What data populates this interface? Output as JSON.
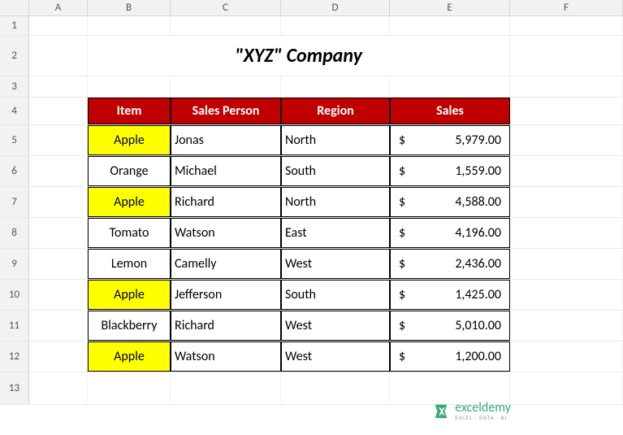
{
  "columns": [
    "A",
    "B",
    "C",
    "D",
    "E",
    "F"
  ],
  "row_labels": [
    "1",
    "2",
    "3",
    "4",
    "5",
    "6",
    "7",
    "8",
    "9",
    "10",
    "11",
    "12",
    "13"
  ],
  "title": "\"XYZ\" Company",
  "headers": {
    "item": "Item",
    "sales_person": "Sales Person",
    "region": "Region",
    "sales": "Sales"
  },
  "rows": [
    {
      "item": "Apple",
      "highlight": true,
      "sales_person": "Jonas",
      "region": "North",
      "currency": "$",
      "sales": "5,979.00"
    },
    {
      "item": "Orange",
      "highlight": false,
      "sales_person": "Michael",
      "region": "South",
      "currency": "$",
      "sales": "1,559.00"
    },
    {
      "item": "Apple",
      "highlight": true,
      "sales_person": "Richard",
      "region": "North",
      "currency": "$",
      "sales": "4,588.00"
    },
    {
      "item": "Tomato",
      "highlight": false,
      "sales_person": "Watson",
      "region": "East",
      "currency": "$",
      "sales": "4,196.00"
    },
    {
      "item": "Lemon",
      "highlight": false,
      "sales_person": "Camelly",
      "region": "West",
      "currency": "$",
      "sales": "2,436.00"
    },
    {
      "item": "Apple",
      "highlight": true,
      "sales_person": "Jefferson",
      "region": "South",
      "currency": "$",
      "sales": "1,425.00"
    },
    {
      "item": "Blackberry",
      "highlight": false,
      "sales_person": "Richard",
      "region": "West",
      "currency": "$",
      "sales": "5,010.00"
    },
    {
      "item": "Apple",
      "highlight": true,
      "sales_person": "Watson",
      "region": "West",
      "currency": "$",
      "sales": "1,200.00"
    }
  ],
  "watermark": {
    "main": "exceldemy",
    "sub": "EXCEL · DATA · BI"
  },
  "chart_data": {
    "type": "table",
    "title": "\"XYZ\" Company",
    "columns": [
      "Item",
      "Sales Person",
      "Region",
      "Sales"
    ],
    "data": [
      [
        "Apple",
        "Jonas",
        "North",
        5979.0
      ],
      [
        "Orange",
        "Michael",
        "South",
        1559.0
      ],
      [
        "Apple",
        "Richard",
        "North",
        4588.0
      ],
      [
        "Tomato",
        "Watson",
        "East",
        4196.0
      ],
      [
        "Lemon",
        "Camelly",
        "West",
        2436.0
      ],
      [
        "Apple",
        "Jefferson",
        "South",
        1425.0
      ],
      [
        "Blackberry",
        "Richard",
        "West",
        5010.0
      ],
      [
        "Apple",
        "Watson",
        "West",
        1200.0
      ]
    ]
  }
}
